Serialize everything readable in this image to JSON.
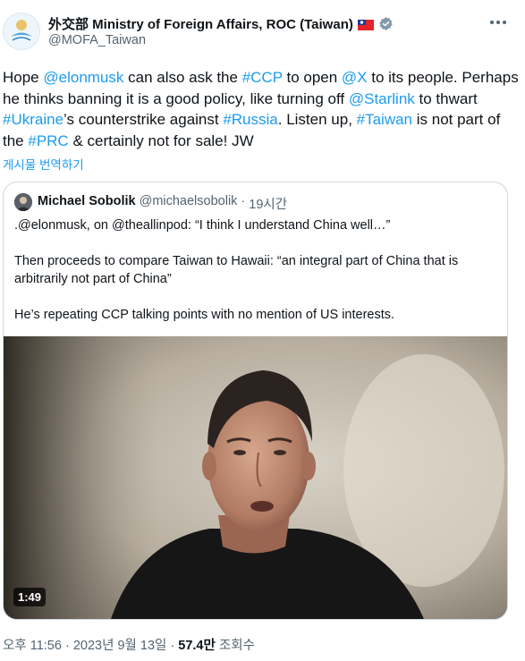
{
  "author": {
    "display_name": "外交部 Ministry of Foreign Affairs, ROC (Taiwan)",
    "handle": "@MOFA_Taiwan",
    "flag_icon": "taiwan-flag",
    "badge_icon": "verified-badge"
  },
  "tweet": {
    "segments": [
      {
        "text": "Hope ",
        "link": false
      },
      {
        "text": "@elonmusk",
        "link": true
      },
      {
        "text": " can also ask the ",
        "link": false
      },
      {
        "text": "#CCP",
        "link": true
      },
      {
        "text": " to open ",
        "link": false
      },
      {
        "text": "@X",
        "link": true
      },
      {
        "text": " to its people. Perhaps he thinks banning it is a good policy, like turning off ",
        "link": false
      },
      {
        "text": "@Starlink",
        "link": true
      },
      {
        "text": " to thwart ",
        "link": false
      },
      {
        "text": "#Ukraine",
        "link": true
      },
      {
        "text": "’s counterstrike against ",
        "link": false
      },
      {
        "text": "#Russia",
        "link": true
      },
      {
        "text": ". Listen up, ",
        "link": false
      },
      {
        "text": "#Taiwan",
        "link": true
      },
      {
        "text": " is not part of the ",
        "link": false
      },
      {
        "text": "#PRC",
        "link": true
      },
      {
        "text": " & certainly not for sale! JW",
        "link": false
      }
    ],
    "translate_label": "게시물 번역하기"
  },
  "quote": {
    "name": "Michael Sobolik",
    "handle": "@michaelsobolik",
    "separator": "·",
    "time": "19시간",
    "paragraphs": [
      ".@elonmusk, on @theallinpod: “I think I understand China well…”",
      "Then proceeds to compare Taiwan to Hawaii: “an integral part of China that is arbitrarily not part of China”",
      "He’s repeating CCP talking points with no mention of US interests."
    ],
    "video_duration": "1:49"
  },
  "footer": {
    "time": "오후 11:56",
    "dot": "·",
    "date": "2023년 9월 13일",
    "views": "57.4만",
    "views_label": "조회수"
  },
  "colors": {
    "link": "#1d9bf0",
    "text": "#0f1419",
    "secondary": "#536471",
    "border": "#cfd9de"
  }
}
